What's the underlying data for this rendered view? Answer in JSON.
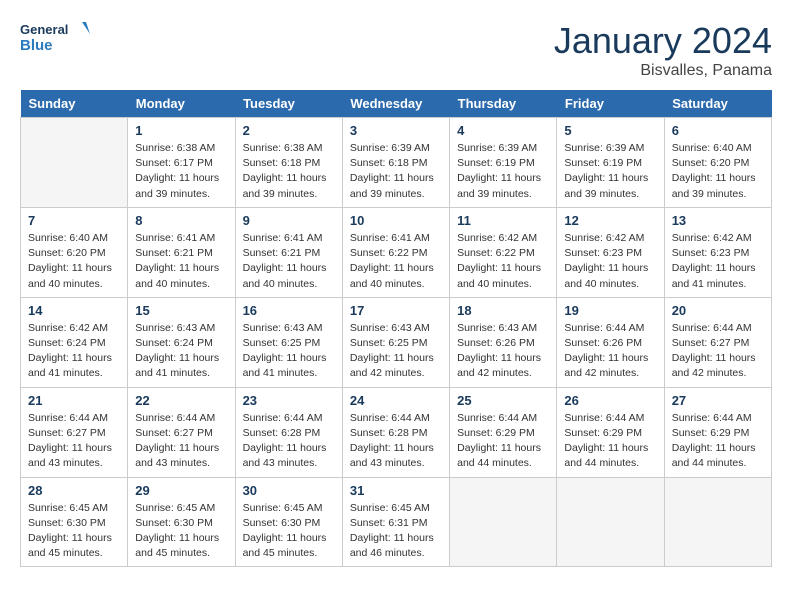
{
  "header": {
    "logo_line1": "General",
    "logo_line2": "Blue",
    "month": "January 2024",
    "location": "Bisvalles, Panama"
  },
  "days_of_week": [
    "Sunday",
    "Monday",
    "Tuesday",
    "Wednesday",
    "Thursday",
    "Friday",
    "Saturday"
  ],
  "weeks": [
    [
      {
        "day": "",
        "empty": true
      },
      {
        "day": "1",
        "sunrise": "6:38 AM",
        "sunset": "6:17 PM",
        "daylight": "11 hours and 39 minutes."
      },
      {
        "day": "2",
        "sunrise": "6:38 AM",
        "sunset": "6:18 PM",
        "daylight": "11 hours and 39 minutes."
      },
      {
        "day": "3",
        "sunrise": "6:39 AM",
        "sunset": "6:18 PM",
        "daylight": "11 hours and 39 minutes."
      },
      {
        "day": "4",
        "sunrise": "6:39 AM",
        "sunset": "6:19 PM",
        "daylight": "11 hours and 39 minutes."
      },
      {
        "day": "5",
        "sunrise": "6:39 AM",
        "sunset": "6:19 PM",
        "daylight": "11 hours and 39 minutes."
      },
      {
        "day": "6",
        "sunrise": "6:40 AM",
        "sunset": "6:20 PM",
        "daylight": "11 hours and 39 minutes."
      }
    ],
    [
      {
        "day": "7",
        "sunrise": "6:40 AM",
        "sunset": "6:20 PM",
        "daylight": "11 hours and 40 minutes."
      },
      {
        "day": "8",
        "sunrise": "6:41 AM",
        "sunset": "6:21 PM",
        "daylight": "11 hours and 40 minutes."
      },
      {
        "day": "9",
        "sunrise": "6:41 AM",
        "sunset": "6:21 PM",
        "daylight": "11 hours and 40 minutes."
      },
      {
        "day": "10",
        "sunrise": "6:41 AM",
        "sunset": "6:22 PM",
        "daylight": "11 hours and 40 minutes."
      },
      {
        "day": "11",
        "sunrise": "6:42 AM",
        "sunset": "6:22 PM",
        "daylight": "11 hours and 40 minutes."
      },
      {
        "day": "12",
        "sunrise": "6:42 AM",
        "sunset": "6:23 PM",
        "daylight": "11 hours and 40 minutes."
      },
      {
        "day": "13",
        "sunrise": "6:42 AM",
        "sunset": "6:23 PM",
        "daylight": "11 hours and 41 minutes."
      }
    ],
    [
      {
        "day": "14",
        "sunrise": "6:42 AM",
        "sunset": "6:24 PM",
        "daylight": "11 hours and 41 minutes."
      },
      {
        "day": "15",
        "sunrise": "6:43 AM",
        "sunset": "6:24 PM",
        "daylight": "11 hours and 41 minutes."
      },
      {
        "day": "16",
        "sunrise": "6:43 AM",
        "sunset": "6:25 PM",
        "daylight": "11 hours and 41 minutes."
      },
      {
        "day": "17",
        "sunrise": "6:43 AM",
        "sunset": "6:25 PM",
        "daylight": "11 hours and 42 minutes."
      },
      {
        "day": "18",
        "sunrise": "6:43 AM",
        "sunset": "6:26 PM",
        "daylight": "11 hours and 42 minutes."
      },
      {
        "day": "19",
        "sunrise": "6:44 AM",
        "sunset": "6:26 PM",
        "daylight": "11 hours and 42 minutes."
      },
      {
        "day": "20",
        "sunrise": "6:44 AM",
        "sunset": "6:27 PM",
        "daylight": "11 hours and 42 minutes."
      }
    ],
    [
      {
        "day": "21",
        "sunrise": "6:44 AM",
        "sunset": "6:27 PM",
        "daylight": "11 hours and 43 minutes."
      },
      {
        "day": "22",
        "sunrise": "6:44 AM",
        "sunset": "6:27 PM",
        "daylight": "11 hours and 43 minutes."
      },
      {
        "day": "23",
        "sunrise": "6:44 AM",
        "sunset": "6:28 PM",
        "daylight": "11 hours and 43 minutes."
      },
      {
        "day": "24",
        "sunrise": "6:44 AM",
        "sunset": "6:28 PM",
        "daylight": "11 hours and 43 minutes."
      },
      {
        "day": "25",
        "sunrise": "6:44 AM",
        "sunset": "6:29 PM",
        "daylight": "11 hours and 44 minutes."
      },
      {
        "day": "26",
        "sunrise": "6:44 AM",
        "sunset": "6:29 PM",
        "daylight": "11 hours and 44 minutes."
      },
      {
        "day": "27",
        "sunrise": "6:44 AM",
        "sunset": "6:29 PM",
        "daylight": "11 hours and 44 minutes."
      }
    ],
    [
      {
        "day": "28",
        "sunrise": "6:45 AM",
        "sunset": "6:30 PM",
        "daylight": "11 hours and 45 minutes."
      },
      {
        "day": "29",
        "sunrise": "6:45 AM",
        "sunset": "6:30 PM",
        "daylight": "11 hours and 45 minutes."
      },
      {
        "day": "30",
        "sunrise": "6:45 AM",
        "sunset": "6:30 PM",
        "daylight": "11 hours and 45 minutes."
      },
      {
        "day": "31",
        "sunrise": "6:45 AM",
        "sunset": "6:31 PM",
        "daylight": "11 hours and 46 minutes."
      },
      {
        "day": "",
        "empty": true
      },
      {
        "day": "",
        "empty": true
      },
      {
        "day": "",
        "empty": true
      }
    ]
  ]
}
